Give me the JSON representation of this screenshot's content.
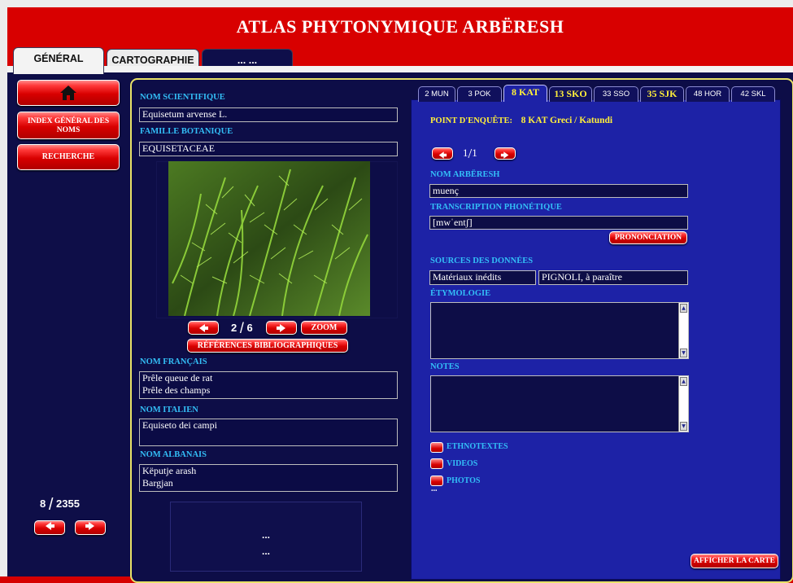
{
  "app_title": "ATLAS PHYTONYMIQUE ARBËRESH",
  "main_tabs": [
    "GÉNÉRAL",
    "CARTOGRAPHIE",
    "... ..."
  ],
  "sidebar": {
    "home_icon": "house-icon",
    "index_label": "INDEX GÉNÉRAL DES NOMS",
    "search_label": "RECHERCHE",
    "record_current": "8",
    "record_total": "2355",
    "sep": "/"
  },
  "left": {
    "scientific_label": "NOM SCIENTIFIQUE",
    "scientific_value": "Equisetum arvense L.",
    "family_label": "FAMILLE BOTANIQUE",
    "family_value": "EQUISETACEAE",
    "photo_current": "2",
    "photo_total": "6",
    "zoom_label": "ZOOM",
    "refs_label": "RÉFÉRENCES BIBLIOGRAPHIQUES",
    "french_label": "NOM FRANÇAIS",
    "french_values": [
      "Prêle queue de rat",
      "Prêle des champs"
    ],
    "italian_label": "NOM ITALIEN",
    "italian_values": [
      "Equiseto dei campi"
    ],
    "albanian_label": "NOM ALBANAIS",
    "albanian_values": [
      "Këputje arash",
      "Bargjan"
    ],
    "extra_lines": [
      "...",
      "..."
    ]
  },
  "right": {
    "tabs": [
      "2 MUN",
      "3 POK",
      "8 KAT",
      "13 SKO",
      "33 SSO",
      "35 SJK",
      "48 HOR",
      "42 SKL"
    ],
    "active_tab": "8 KAT",
    "point_label": "POINT D'ENQUÊTE:",
    "point_value": "8 KAT Greci / Katundi",
    "loc_current": "1",
    "loc_total": "1",
    "arb_label": "NOM ARBËRESH",
    "arb_value": "muenç",
    "phon_label": "TRANSCRIPTION PHONÉTIQUE",
    "phon_value": "[mwˈentʃ]",
    "pron_label": "PRONONCIATION",
    "sources_label": "SOURCES DES DONNÉES",
    "source_1": "Matériaux inédits",
    "source_2": "PIGNOLI, à paraître",
    "etym_label": "ÉTYMOLOGIE",
    "notes_label": "NOTES",
    "media": [
      "ETHNOTEXTES",
      "VIDEOS",
      "PHOTOS"
    ],
    "ellipsis": "...",
    "map_button": "AFFICHER LA CARTE"
  },
  "colors": {
    "brand_red": "#d80000",
    "navy": "#0e0e48",
    "panel_blue": "#1d22a6",
    "label_cyan": "#33bff7",
    "accent_yellow": "#ffef3a"
  }
}
